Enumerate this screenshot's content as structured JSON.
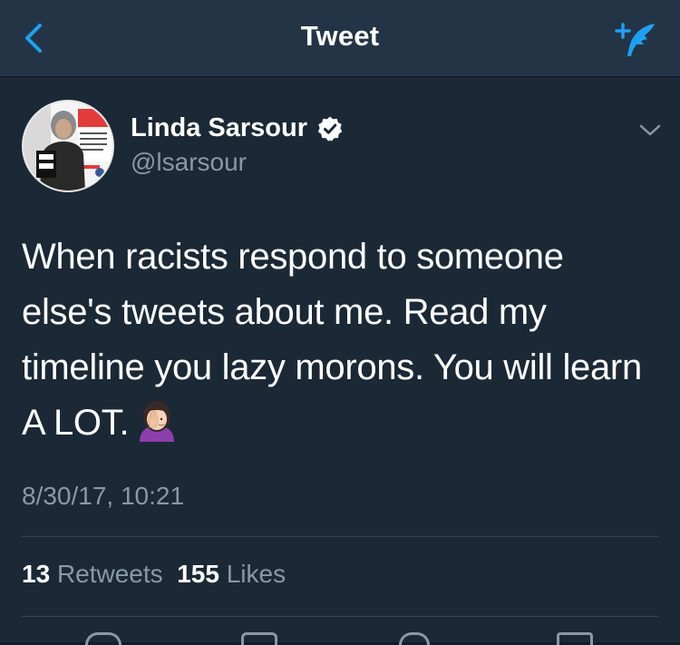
{
  "navbar": {
    "title": "Tweet",
    "back_icon": "chevron-left-icon",
    "compose_icon": "compose-tweet-icon",
    "accent_color": "#1da1f2"
  },
  "tweet": {
    "author_name": "Linda Sarsour",
    "author_handle": "@lsarsour",
    "verified": true,
    "text": "When racists respond to someone else's tweets about me. Read my timeline you lazy morons. You will learn A LOT.",
    "emoji": "woman-facepalming-emoji",
    "timestamp": "8/30/17, 10:21",
    "retweets_count": "13",
    "retweets_label": "Retweets",
    "likes_count": "155",
    "likes_label": "Likes"
  },
  "colors": {
    "background": "#1b2836",
    "navbar": "#243447",
    "secondary_text": "#8899a6",
    "divider": "#38444d"
  }
}
